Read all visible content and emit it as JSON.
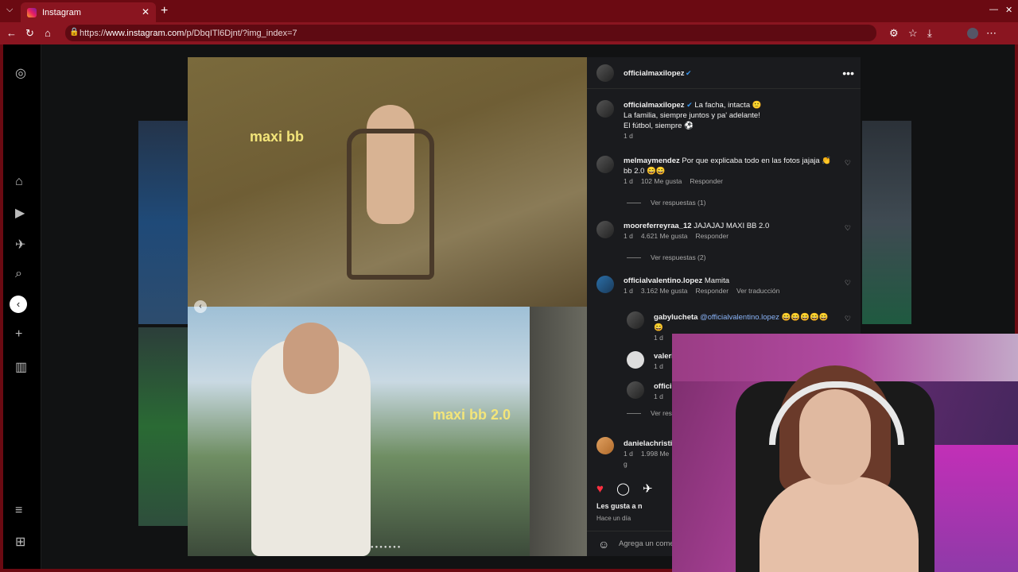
{
  "browser": {
    "tab_title": "Instagram",
    "url_prefix": "https://",
    "url_host": "www.instagram.com",
    "url_path": "/p/DbqITl6Djnt/?img_index=7",
    "new_tab": "+",
    "tab_close": "✕",
    "minimize": "—",
    "close": "✕"
  },
  "post": {
    "author": "officialmaxilopez",
    "caption_line1": "La facha, intacta 🙂",
    "caption_line2": "La familia, siempre juntos y pa' adelante!",
    "caption_line3": "El fútbol, siempre ⚽",
    "caption_time": "1 d",
    "overlay1": "maxi bb",
    "overlay2": "maxi bb 2.0",
    "likes_text": "Les gusta a n",
    "posted_ago": "Hace un día",
    "add_comment_placeholder": "Agrega un come"
  },
  "comments": [
    {
      "user": "melmaymendez",
      "text": "Por que explicaba todo en las fotos jajaja 👏",
      "text2": "bb 2.0 😄😄",
      "time": "1 d",
      "likes": "102 Me gusta",
      "reply": "Responder",
      "view_replies": "Ver respuestas (1)"
    },
    {
      "user": "mooreferreyraa_12",
      "text": "JAJAJAJ MAXI BB 2.0",
      "time": "1 d",
      "likes": "4.621 Me gusta",
      "reply": "Responder",
      "view_replies": "Ver respuestas (2)"
    },
    {
      "user": "officialvalentino.lopez",
      "text": "Mamita",
      "time": "1 d",
      "likes": "3.162 Me gusta",
      "reply": "Responder",
      "translate": "Ver traducción"
    },
    {
      "user": "gabylucheta",
      "mention": "@officialvalentino.lopez",
      "text": "😄😄😄😄😄",
      "text2": "😄",
      "time": "1 d"
    },
    {
      "user": "valeri",
      "time": "1 d"
    },
    {
      "user": "offici",
      "time": "1 d",
      "view_replies": "Ver resp"
    },
    {
      "user": "danielachristia",
      "time": "1 d",
      "likes": "1.998 Me g"
    }
  ],
  "icons": [
    "instagram-logo-icon",
    "home-icon",
    "reels-icon",
    "messages-icon",
    "search-icon",
    "create-icon",
    "dashboard-icon",
    "menu-icon",
    "heart-icon",
    "comment-icon",
    "share-icon",
    "more-icon"
  ],
  "colors": {
    "browser_accent": "#8a1520",
    "liked_heart": "#ff3040",
    "mention": "#8ab4f8"
  }
}
